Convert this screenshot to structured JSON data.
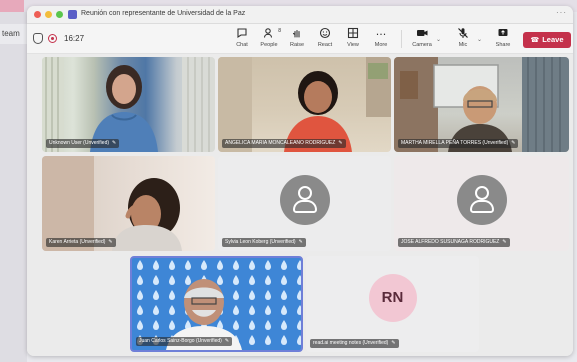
{
  "background": {
    "left_tab": "team"
  },
  "window": {
    "title": "Reunión con representante de Universidad de la Paz",
    "more": "···"
  },
  "toolbar": {
    "timer": "16:27",
    "buttons": {
      "chat": "Chat",
      "people": "People",
      "people_count": "8",
      "raise": "Raise",
      "react": "React",
      "view": "View",
      "more": "More",
      "camera": "Camera",
      "mic": "Mic",
      "share": "Share"
    },
    "leave": "Leave"
  },
  "colors": {
    "leave": "#c4314b",
    "avatar": "#8a8a8a",
    "rn_avatar": "#f2c7d3"
  },
  "participants": [
    {
      "name": "Unknown User (Unverified)",
      "video": true
    },
    {
      "name": "ANGELICA MARIA MONCALEANO RODRIGUEZ",
      "video": true
    },
    {
      "name": "MARTHA MIRELLA PEÑA TORRES (Unverified)",
      "video": true
    },
    {
      "name": "Karen Arrieta (Unverified)",
      "video": true
    },
    {
      "name": "Sylvia Leon Koberg (Unverified)",
      "video": false
    },
    {
      "name": "JOSE ALFREDO SUSUNAGA RODRIGUEZ",
      "video": false
    },
    {
      "name": "Juan Carlos Sainz-Borgo (Unverified)",
      "video": true
    },
    {
      "name": "read.ai meeting notes (Unverified)",
      "video": false,
      "initials": "RN"
    }
  ]
}
